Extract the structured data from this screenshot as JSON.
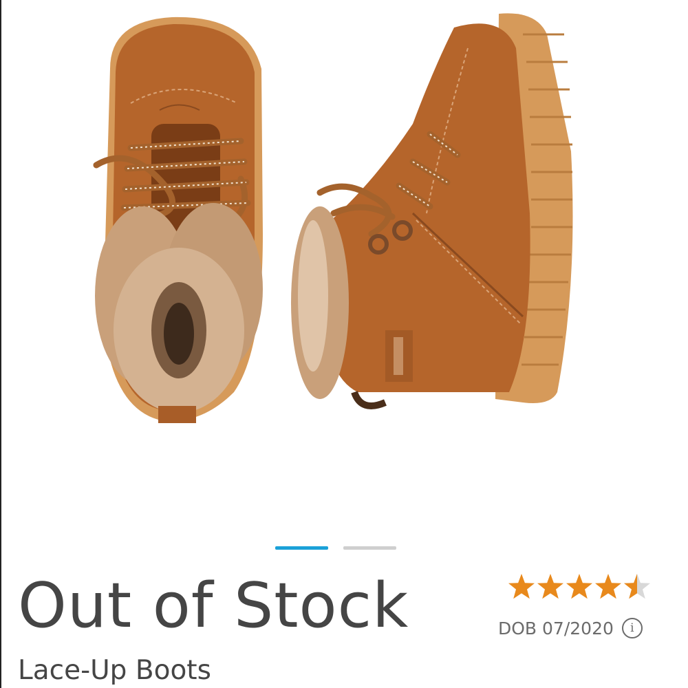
{
  "carousel": {
    "slide_count": 2,
    "active_index": 0,
    "colors": {
      "active": "#1ba1d8",
      "inactive": "#cfcfcf"
    }
  },
  "product": {
    "status": "Out of Stock",
    "name": "Lace-Up Boots",
    "image_icon": "boots-photo",
    "rating": {
      "value": 4.5,
      "max": 5,
      "star_color": "#e8891c",
      "empty_color": "#d8d8d8"
    },
    "dob_label": "DOB 07/2020",
    "info_icon": "info-icon"
  },
  "colors": {
    "leather": "#b5652b",
    "sole": "#d69a5a",
    "fur": "#c9a07a",
    "lace": "#a4622c",
    "text": "#454545"
  }
}
